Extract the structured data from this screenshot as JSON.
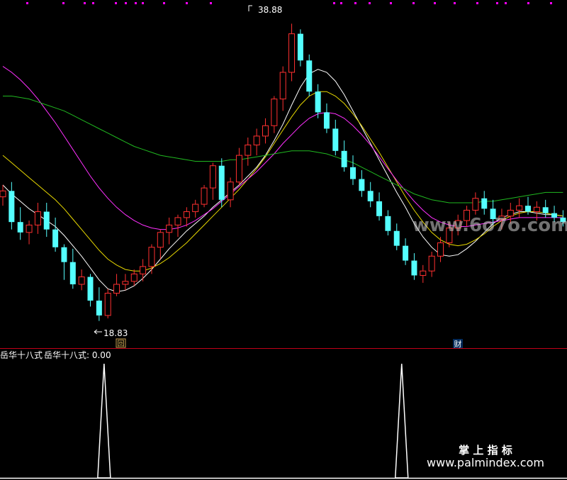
{
  "price_high_label": "38.88",
  "price_low_label": "18.83",
  "marker_hui": "回",
  "marker_cai": "财",
  "indicator": {
    "name": "岳华十八式",
    "value_text": "岳华十八式: 0.00"
  },
  "watermark": {
    "mid_text": "www.6o7o.com",
    "brand_text": "掌 上 指 标",
    "url_text": "www.palmindex.com"
  },
  "colors": {
    "up": "#ff3030",
    "down": "#54ffff",
    "ma_white": "#ffffff",
    "ma_yellow": "#e8d800",
    "ma_purple": "#ff30ff",
    "ma_green": "#20b820",
    "separator": "#c00018",
    "dot": "#ff00ff"
  },
  "chart_data": {
    "type": "candlestick",
    "y_range": [
      18.0,
      40.0
    ],
    "high": 38.88,
    "low": 18.83,
    "candles": [
      [
        27.2,
        28.0,
        26.6,
        27.6
      ],
      [
        27.6,
        28.2,
        25.0,
        25.5
      ],
      [
        25.5,
        26.5,
        24.3,
        24.8
      ],
      [
        24.8,
        25.6,
        24.0,
        25.3
      ],
      [
        25.3,
        26.8,
        24.7,
        26.2
      ],
      [
        26.2,
        26.8,
        24.5,
        25.0
      ],
      [
        25.0,
        25.8,
        23.5,
        23.8
      ],
      [
        23.8,
        24.0,
        21.6,
        22.8
      ],
      [
        22.8,
        23.7,
        21.0,
        21.3
      ],
      [
        21.3,
        22.3,
        20.9,
        21.8
      ],
      [
        21.8,
        22.0,
        19.8,
        20.2
      ],
      [
        20.2,
        21.1,
        18.83,
        19.2
      ],
      [
        19.2,
        21.0,
        19.0,
        20.7
      ],
      [
        20.7,
        22.0,
        20.5,
        21.3
      ],
      [
        21.3,
        22.0,
        20.9,
        21.5
      ],
      [
        21.5,
        22.3,
        21.2,
        22.0
      ],
      [
        22.0,
        23.0,
        21.5,
        22.5
      ],
      [
        22.5,
        24.0,
        22.0,
        23.8
      ],
      [
        23.8,
        25.0,
        23.0,
        24.8
      ],
      [
        24.8,
        25.8,
        24.0,
        25.3
      ],
      [
        25.3,
        26.0,
        24.5,
        25.8
      ],
      [
        25.8,
        26.5,
        25.2,
        26.2
      ],
      [
        26.2,
        27.0,
        25.8,
        26.7
      ],
      [
        26.7,
        28.0,
        26.5,
        27.8
      ],
      [
        27.8,
        29.5,
        27.0,
        29.3
      ],
      [
        29.3,
        29.8,
        26.5,
        27.0
      ],
      [
        27.0,
        28.5,
        26.5,
        28.2
      ],
      [
        28.2,
        30.5,
        28.0,
        30.0
      ],
      [
        30.0,
        31.2,
        29.3,
        30.7
      ],
      [
        30.7,
        31.8,
        30.0,
        31.3
      ],
      [
        31.3,
        32.5,
        30.8,
        32.0
      ],
      [
        32.0,
        34.0,
        31.5,
        33.8
      ],
      [
        33.8,
        36.0,
        33.0,
        35.6
      ],
      [
        35.6,
        38.88,
        35.0,
        38.2
      ],
      [
        38.2,
        38.5,
        36.0,
        36.4
      ],
      [
        36.4,
        36.8,
        34.0,
        34.3
      ],
      [
        34.3,
        34.8,
        32.5,
        32.9
      ],
      [
        32.9,
        33.5,
        31.5,
        31.8
      ],
      [
        31.8,
        32.4,
        30.0,
        30.3
      ],
      [
        30.3,
        31.0,
        28.9,
        29.2
      ],
      [
        29.2,
        30.0,
        28.0,
        28.4
      ],
      [
        28.4,
        29.0,
        27.2,
        27.6
      ],
      [
        27.6,
        28.2,
        26.5,
        26.9
      ],
      [
        26.9,
        27.5,
        25.6,
        25.9
      ],
      [
        25.9,
        26.3,
        24.6,
        24.9
      ],
      [
        24.9,
        25.4,
        23.6,
        23.9
      ],
      [
        23.9,
        24.4,
        22.6,
        22.9
      ],
      [
        22.9,
        23.4,
        21.6,
        21.9
      ],
      [
        21.9,
        22.6,
        21.4,
        22.2
      ],
      [
        22.2,
        23.5,
        21.8,
        23.2
      ],
      [
        23.2,
        24.5,
        22.8,
        24.1
      ],
      [
        24.1,
        25.5,
        23.8,
        25.1
      ],
      [
        25.1,
        26.0,
        24.6,
        25.6
      ],
      [
        25.6,
        26.6,
        25.2,
        26.3
      ],
      [
        26.3,
        27.5,
        26.0,
        27.1
      ],
      [
        27.1,
        27.6,
        26.0,
        26.4
      ],
      [
        26.4,
        27.0,
        25.3,
        25.7
      ],
      [
        25.7,
        26.4,
        25.0,
        25.9
      ],
      [
        25.9,
        26.8,
        25.4,
        26.3
      ],
      [
        26.3,
        27.1,
        25.8,
        26.6
      ],
      [
        26.6,
        27.2,
        26.0,
        26.2
      ],
      [
        26.2,
        26.9,
        25.6,
        26.5
      ],
      [
        26.5,
        27.0,
        25.8,
        26.1
      ],
      [
        26.1,
        26.6,
        25.5,
        25.8
      ],
      [
        25.8,
        26.3,
        25.2,
        25.5
      ]
    ],
    "ma_series": [
      {
        "color": "white",
        "values": [
          28.0,
          27.4,
          26.9,
          26.4,
          26.0,
          25.6,
          25.2,
          24.6,
          23.9,
          23.2,
          22.4,
          21.6,
          21.0,
          20.8,
          20.9,
          21.2,
          21.7,
          22.3,
          23.0,
          23.7,
          24.3,
          24.9,
          25.4,
          25.9,
          26.5,
          27.0,
          27.5,
          28.0,
          28.6,
          29.2,
          30.0,
          31.0,
          32.1,
          33.4,
          34.6,
          35.5,
          35.8,
          35.6,
          35.0,
          34.1,
          33.0,
          31.9,
          30.8,
          29.7,
          28.6,
          27.5,
          26.5,
          25.4,
          24.5,
          23.8,
          23.3,
          23.2,
          23.3,
          23.7,
          24.2,
          24.8,
          25.4,
          25.8,
          26.0,
          26.2,
          26.2,
          26.1,
          26.0,
          26.0,
          25.9
        ]
      },
      {
        "color": "yellow",
        "values": [
          30.0,
          29.5,
          29.0,
          28.5,
          28.0,
          27.5,
          27.0,
          26.4,
          25.7,
          25.0,
          24.3,
          23.6,
          23.0,
          22.6,
          22.3,
          22.2,
          22.2,
          22.4,
          22.7,
          23.1,
          23.6,
          24.1,
          24.7,
          25.3,
          25.9,
          26.5,
          27.1,
          27.7,
          28.4,
          29.1,
          29.9,
          30.8,
          31.7,
          32.6,
          33.4,
          34.0,
          34.3,
          34.3,
          34.0,
          33.5,
          32.8,
          32.0,
          31.1,
          30.2,
          29.2,
          28.2,
          27.2,
          26.3,
          25.5,
          24.8,
          24.3,
          24.0,
          23.9,
          24.0,
          24.3,
          24.7,
          25.2,
          25.6,
          25.9,
          26.1,
          26.2,
          26.2,
          26.1,
          26.0,
          25.9
        ]
      },
      {
        "color": "purple",
        "values": [
          36.0,
          35.6,
          35.1,
          34.5,
          33.8,
          33.0,
          32.2,
          31.3,
          30.4,
          29.5,
          28.6,
          27.8,
          27.1,
          26.5,
          26.0,
          25.6,
          25.3,
          25.1,
          25.0,
          25.0,
          25.1,
          25.3,
          25.6,
          26.0,
          26.4,
          26.9,
          27.4,
          27.9,
          28.4,
          28.9,
          29.5,
          30.1,
          30.8,
          31.4,
          32.0,
          32.5,
          32.8,
          32.9,
          32.8,
          32.5,
          32.0,
          31.4,
          30.7,
          29.9,
          29.1,
          28.3,
          27.6,
          26.9,
          26.3,
          25.8,
          25.5,
          25.3,
          25.2,
          25.2,
          25.3,
          25.4,
          25.5,
          25.6,
          25.7,
          25.8,
          25.8,
          25.8,
          25.8,
          25.8,
          25.8
        ]
      },
      {
        "color": "green",
        "values": [
          34.0,
          34.0,
          33.9,
          33.8,
          33.6,
          33.4,
          33.2,
          33.0,
          32.7,
          32.4,
          32.1,
          31.8,
          31.5,
          31.2,
          30.9,
          30.6,
          30.4,
          30.2,
          30.0,
          29.9,
          29.8,
          29.7,
          29.6,
          29.6,
          29.6,
          29.6,
          29.7,
          29.7,
          29.8,
          29.9,
          30.0,
          30.1,
          30.2,
          30.3,
          30.3,
          30.3,
          30.2,
          30.1,
          29.9,
          29.7,
          29.5,
          29.2,
          28.9,
          28.6,
          28.3,
          28.0,
          27.7,
          27.4,
          27.2,
          27.0,
          26.9,
          26.8,
          26.8,
          26.8,
          26.8,
          26.9,
          26.9,
          27.0,
          27.1,
          27.2,
          27.3,
          27.4,
          27.5,
          27.5,
          27.5
        ]
      }
    ],
    "indicator_signals": [
      11,
      45
    ]
  }
}
